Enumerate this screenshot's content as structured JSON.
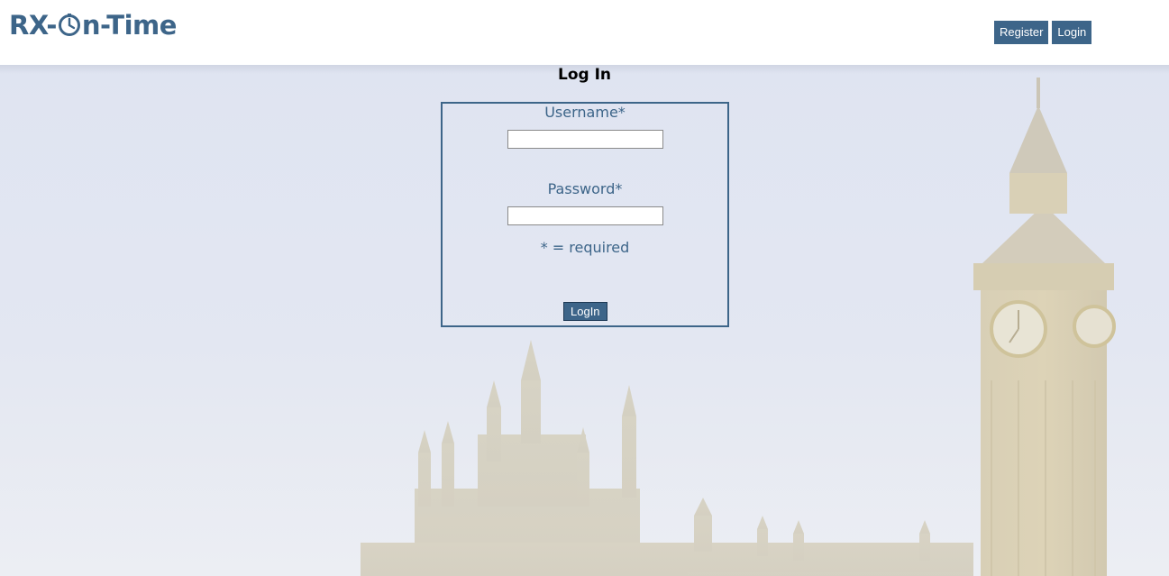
{
  "header": {
    "logo_prefix": "RX-",
    "logo_suffix": "n-Time",
    "logo_icon": "clock-icon",
    "nav": [
      {
        "label": "Register"
      },
      {
        "label": "Login"
      }
    ]
  },
  "page": {
    "title": "Log In"
  },
  "form": {
    "username_label": "Username*",
    "username_value": "",
    "password_label": "Password*",
    "password_value": "",
    "required_note": "* = required",
    "submit_label": "LogIn"
  },
  "colors": {
    "brand": "#3d6589",
    "background_sky": "#e0e5f1"
  },
  "background": {
    "image": "Big Ben and Palace of Westminster (faded)"
  }
}
